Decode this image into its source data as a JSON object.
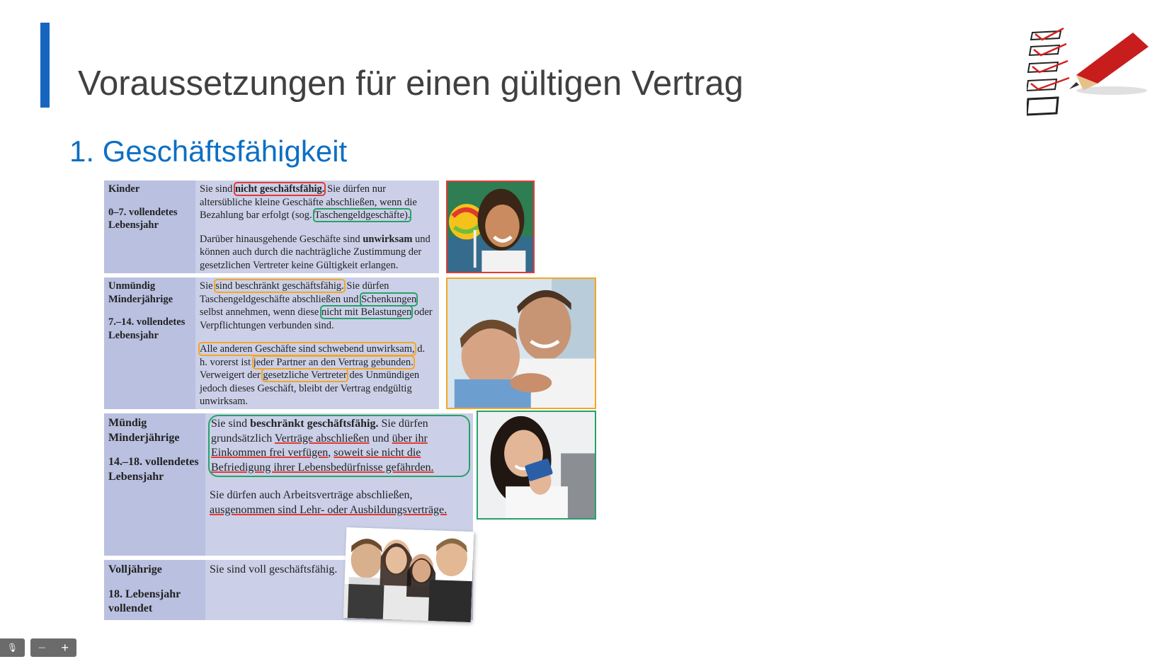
{
  "slide": {
    "title": "Voraussetzungen für einen gültigen Vertrag",
    "subtitle": "1. Geschäftsfähigkeit"
  },
  "rows": {
    "kinder": {
      "label": "Kinder",
      "age": "0–7. vollendetes Lebensjahr",
      "t1": "Sie sind ",
      "t2": "nicht geschäftsfähig.",
      "t3": " Sie dürfen nur altersübliche kleine Geschäfte abschließen, wenn die Bezahlung bar erfolgt (sog. ",
      "t4": "Taschengeldgeschäfte).",
      "t5": "Darüber hinausgehende Geschäfte sind ",
      "t6": "unwirksam",
      "t7": " und können auch durch die nachträgliche Zustimmung der gesetzlichen Vertreter keine Gültigkeit erlangen."
    },
    "unmuendig": {
      "label": "Unmündig Minderjährige",
      "age": "7.–14. vollendetes Lebensjahr",
      "t1": "Sie ",
      "t2": "sind beschränkt geschäftsfähig.",
      "t3": " Sie dürfen Taschengeldgeschäfte abschließen und ",
      "t4": "Schenkungen",
      "t5": " selbst annehmen, wenn diese ",
      "t6": "nicht mit Belastungen",
      "t7": " oder Verpflichtungen verbunden sind.",
      "t8": "Alle anderen Geschäfte sind schwebend unwirksam,",
      "t9": " d. h. vorerst ist ",
      "t10": "jeder Partner an den Vertrag gebunden.",
      "t11": " Verweigert der ",
      "t12": "gesetzliche Vertreter",
      "t13": " des Unmündigen jedoch dieses Geschäft, bleibt der Vertrag endgültig unwirksam."
    },
    "muendig": {
      "label": "Mündig Minderjährige",
      "age": "14.–18. vollendetes Lebensjahr",
      "t1": "Sie sind ",
      "t2": "beschränkt geschäftsfähig.",
      "t3": " Sie dürfen grundsätzlich ",
      "t4": "Verträge abschließen",
      "t5": " und ",
      "t6": "über ihr Einkommen frei verfügen",
      "t7": ", ",
      "t8": "soweit sie nicht die Befriedigung ihrer Lebensbedürfnisse gefährden.",
      "t9": "Sie dürfen auch Arbeitsverträge abschließen, ",
      "t10": "ausgenommen sind Lehr- oder Ausbildungsverträge."
    },
    "volljaehrig": {
      "label": "Volljährige",
      "age": "18. Lebensjahr vollendet",
      "t1": "Sie sind voll geschäftsfähig."
    }
  },
  "controls": {
    "minus": "−",
    "plus": "+"
  },
  "colors": {
    "accent": "#1565c0",
    "subtitle": "#0d6fc4",
    "table_right": "#cbd0e8",
    "table_left": "#b9c0e0",
    "mark_red": "#e53935",
    "mark_green": "#26a269",
    "mark_orange": "#f5a623"
  }
}
